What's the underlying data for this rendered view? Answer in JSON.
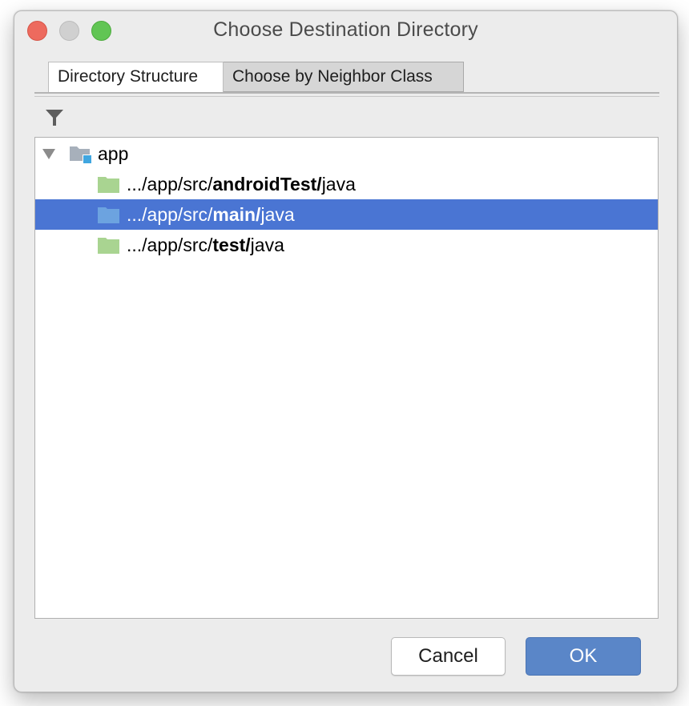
{
  "window": {
    "title": "Choose Destination Directory"
  },
  "tabs": [
    {
      "label": "Directory Structure",
      "active": true
    },
    {
      "label": "Choose by Neighbor Class",
      "active": false
    }
  ],
  "toolbar": {
    "filter_icon": "filter-icon"
  },
  "tree": {
    "root": {
      "label": "app",
      "expanded": true,
      "icon": "module-folder-icon"
    },
    "items": [
      {
        "prefix": ".../app/src/",
        "bold": "androidTest/",
        "suffix": "java",
        "icon": "test-source-folder-icon",
        "selected": false
      },
      {
        "prefix": ".../app/src/",
        "bold": "main/",
        "suffix": "java",
        "icon": "source-folder-icon",
        "selected": true
      },
      {
        "prefix": ".../app/src/",
        "bold": "test/",
        "suffix": "java",
        "icon": "test-source-folder-icon",
        "selected": false
      }
    ]
  },
  "buttons": {
    "cancel_label": "Cancel",
    "ok_label": "OK"
  },
  "colors": {
    "selection": "#4a75d3",
    "ok_button": "#5a86c8",
    "test_folder": "#a9d491",
    "source_folder": "#6ca3e0"
  }
}
